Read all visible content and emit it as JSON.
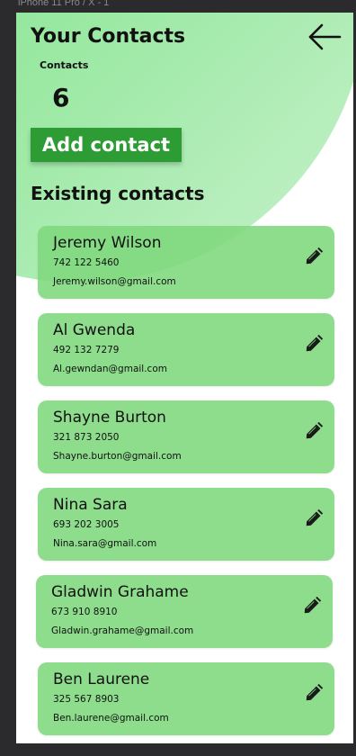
{
  "frame_label": "iPhone 11 Pro / X - 1",
  "header": {
    "title": "Your Contacts",
    "back_icon": "arrow-left-icon"
  },
  "summary": {
    "label": "Contacts",
    "count": "6"
  },
  "add_button": {
    "label": "Add contact",
    "color": "#2d9c34"
  },
  "section_title": "Existing contacts",
  "card_color": "#7ed87c",
  "edit_icon": "pencil-icon",
  "contacts": [
    {
      "name": "Jeremy Wilson",
      "phone": "742 122 5460",
      "email": "Jeremy.wilson@gmail.com"
    },
    {
      "name": "Al Gwenda",
      "phone": "492 132 7279",
      "email": "Al.gewndan@gmail.com"
    },
    {
      "name": "Shayne Burton",
      "phone": "321 873 2050",
      "email": "Shayne.burton@gmail.com"
    },
    {
      "name": "Nina Sara",
      "phone": "693 202 3005",
      "email": "Nina.sara@gmail.com"
    },
    {
      "name": "Gladwin Grahame",
      "phone": "673 910 8910",
      "email": "Gladwin.grahame@gmail.com"
    },
    {
      "name": "Ben Laurene",
      "phone": "325 567 8903",
      "email": "Ben.laurene@gmail.com"
    }
  ]
}
